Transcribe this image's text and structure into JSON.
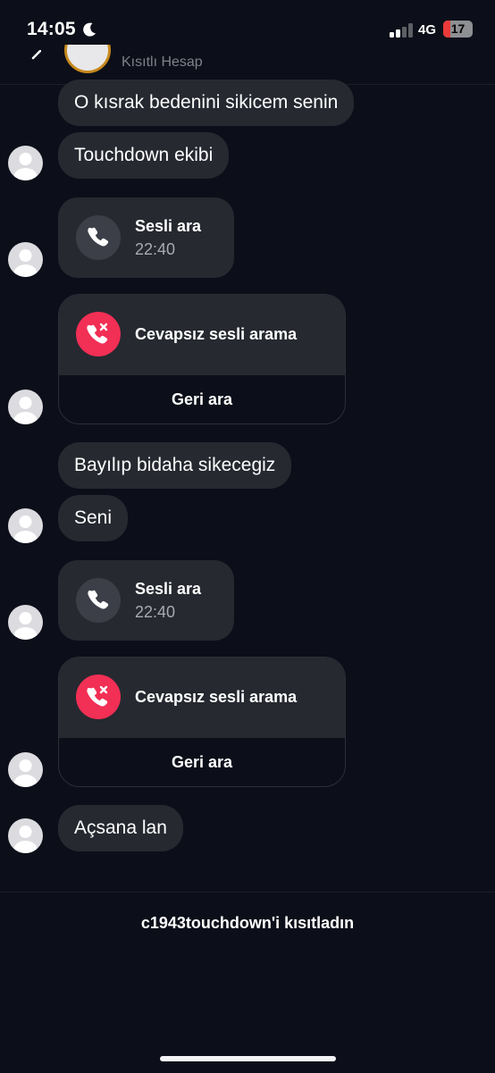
{
  "status_bar": {
    "time": "14:05",
    "network": "4G",
    "battery": "17"
  },
  "header": {
    "subtitle": "Kısıtlı Hesap"
  },
  "messages": [
    {
      "kind": "text",
      "text": "O kısrak bedenini sikicem senin"
    },
    {
      "kind": "text",
      "text": "Touchdown ekibi"
    },
    {
      "kind": "call",
      "title": "Sesli ara",
      "time": "22:40"
    },
    {
      "kind": "missed_call",
      "title": "Cevapsız sesli arama",
      "action": "Geri ara"
    },
    {
      "kind": "text",
      "text": "Bayılıp bidaha sikecegiz"
    },
    {
      "kind": "text",
      "text": "Seni"
    },
    {
      "kind": "call",
      "title": "Sesli ara",
      "time": "22:40"
    },
    {
      "kind": "missed_call",
      "title": "Cevapsız sesli arama",
      "action": "Geri ara"
    },
    {
      "kind": "text",
      "text": "Açsana lan"
    }
  ],
  "footer": {
    "restricted_notice": "c1943touchdown'i kısıtladın"
  },
  "colors": {
    "background": "#0c0f19",
    "bubble": "#262930",
    "missed_call": "#f22f55",
    "avatar_ring": "#c6881c"
  }
}
